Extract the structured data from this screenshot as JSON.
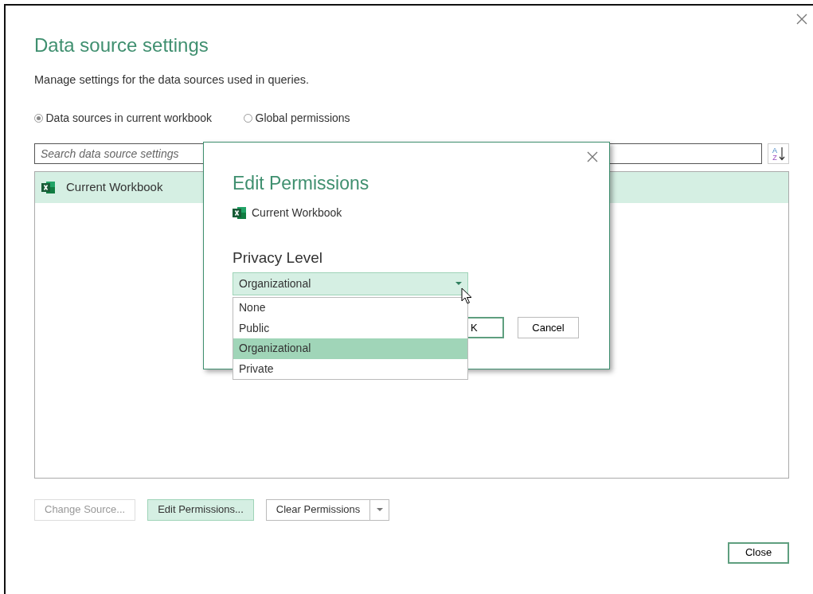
{
  "title": "Data source settings",
  "description": "Manage settings for the data sources used in queries.",
  "scope_options": [
    {
      "label": "Data sources in current workbook",
      "selected": true
    },
    {
      "label": "Global permissions",
      "selected": false
    }
  ],
  "search": {
    "placeholder": "Search data source settings"
  },
  "sort_button": {
    "letters": [
      "A",
      "Z"
    ]
  },
  "sources": [
    {
      "name": "Current Workbook",
      "selected": true
    }
  ],
  "buttons": [
    {
      "label": "Change Source...",
      "kind": "plain",
      "disabled": true,
      "highlighted": false
    },
    {
      "label": "Edit Permissions...",
      "kind": "plain",
      "disabled": false,
      "highlighted": true
    },
    {
      "label": "Clear Permissions",
      "kind": "split",
      "disabled": false,
      "highlighted": false
    }
  ],
  "close_button": {
    "label": "Close"
  },
  "edit_dialog": {
    "title": "Edit Permissions",
    "source_name": "Current Workbook",
    "privacy_label": "Privacy Level",
    "privacy_select": {
      "value": "Organizational",
      "expanded": true
    },
    "options": [
      {
        "label": "None",
        "selected": false
      },
      {
        "label": "Public",
        "selected": false
      },
      {
        "label": "Organizational",
        "selected": true
      },
      {
        "label": "Private",
        "selected": false
      }
    ],
    "ok_button": {
      "label": "K"
    },
    "cancel_button": {
      "label": "Cancel"
    }
  }
}
